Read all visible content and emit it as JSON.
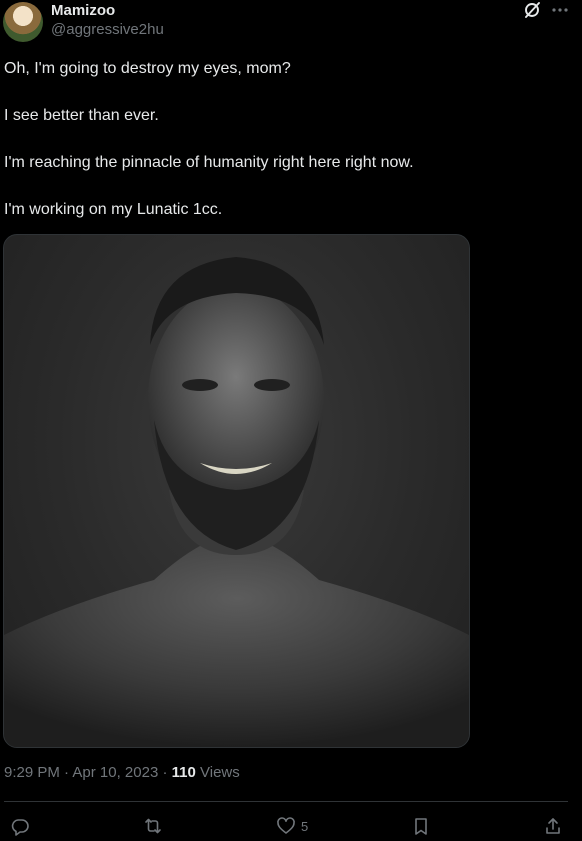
{
  "post": {
    "author": {
      "display_name": "Mamizoo",
      "handle": "@aggressive2hu"
    },
    "text_lines": [
      "Oh, I'm going to destroy my eyes, mom?",
      "I see better than ever.",
      "I'm reaching the pinnacle of humanity right here right now.",
      "I'm working on my Lunatic 1cc."
    ],
    "media": {
      "type": "photo",
      "tone": "grayscale"
    },
    "meta": {
      "time": "9:29 PM",
      "separator1": " · ",
      "date": "Apr 10, 2023",
      "separator2": " · ",
      "views_count": "110",
      "views_label": " Views"
    },
    "actions": {
      "reply": {
        "icon": "reply-icon",
        "count": ""
      },
      "repost": {
        "icon": "repost-icon",
        "count": ""
      },
      "like": {
        "icon": "heart-icon",
        "count": "5"
      },
      "bookmark": {
        "icon": "bookmark-icon",
        "count": ""
      },
      "share": {
        "icon": "share-icon",
        "count": ""
      }
    },
    "header_icons": [
      "grok-icon",
      "more-icon"
    ]
  },
  "colors": {
    "background": "#000000",
    "text_primary": "#e7e9ea",
    "text_secondary": "#71767b",
    "divider": "#2f3336"
  }
}
